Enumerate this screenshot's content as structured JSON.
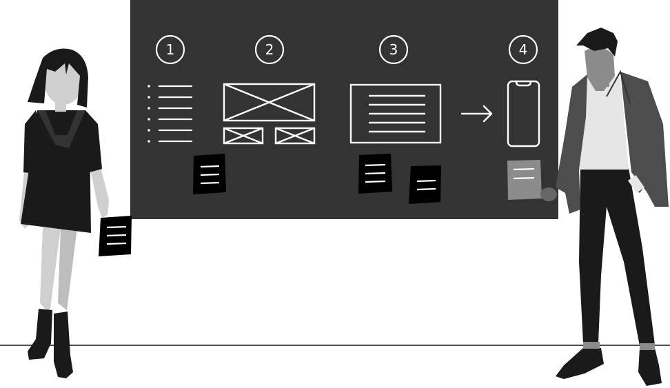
{
  "steps": [
    {
      "number": "1"
    },
    {
      "number": "2"
    },
    {
      "number": "3"
    },
    {
      "number": "4"
    }
  ],
  "colors": {
    "board": "#333333",
    "line_art": "#ffffff",
    "note_dark": "#000000",
    "note_light": "#8c8c8c",
    "floor": "#4d4d4d"
  }
}
